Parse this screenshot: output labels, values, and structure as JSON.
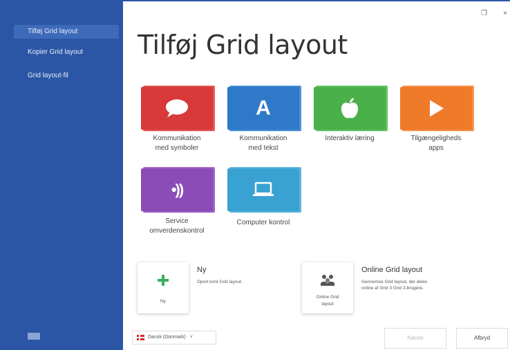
{
  "sidebar": {
    "items": [
      {
        "label": "Tilføj Grid layout"
      },
      {
        "label": "Kopier Grid layout"
      },
      {
        "label": "Grid layout-fil"
      }
    ]
  },
  "window": {
    "restore_glyph": "❐",
    "close_glyph": "×"
  },
  "main": {
    "title": "Tilføj Grid layout",
    "tiles": [
      {
        "label_line1": "Kommunikation",
        "label_line2": "med symboler",
        "color": "#d83a3a",
        "icon": "speech-bubble-icon"
      },
      {
        "label_line1": "Kommunikation",
        "label_line2": "med tekst",
        "color": "#2f7ac8",
        "icon": "letter-a-icon",
        "icon_text": "A"
      },
      {
        "label_line1": "Interaktiv læring",
        "label_line2": "",
        "color": "#4ab04a",
        "icon": "apple-icon"
      },
      {
        "label_line1": "Tilgængeligheds",
        "label_line2": "apps",
        "color": "#ef7a2a",
        "icon": "play-icon"
      },
      {
        "label_line1": "Service",
        "label_line2": "omverdenskontrol",
        "color": "#8a4cb6",
        "icon": "wireless-signal-icon",
        "icon_text": "•))"
      },
      {
        "label_line1": "Computer kontrol",
        "label_line2": "",
        "color": "#3aa2d2",
        "icon": "laptop-icon"
      }
    ],
    "new_option": {
      "card_caption": "Ny",
      "title": "Ny",
      "description": "Opret tomt Grid layout."
    },
    "online_option": {
      "card_caption_line1": "Online Grid",
      "card_caption_line2": "layout",
      "title": "Online Grid layout",
      "description_line1": "Gennemse Grid layout, der deles",
      "description_line2": "online af Grid 3 Grid 3-brugere."
    }
  },
  "footer": {
    "language": "Dansk (Danmark)",
    "language_chevron": "˅",
    "next_label": "Næste",
    "cancel_label": "Afbryd"
  }
}
